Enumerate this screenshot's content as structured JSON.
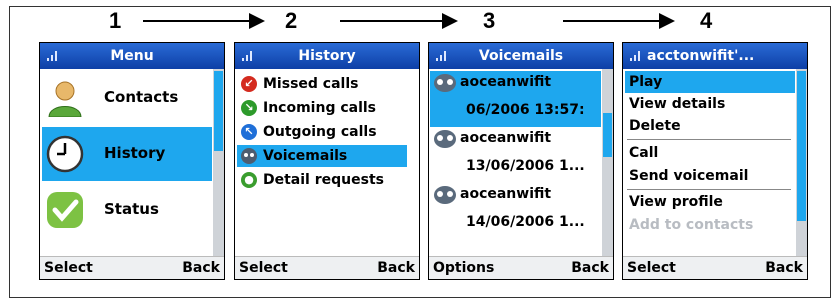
{
  "steps": [
    "1",
    "2",
    "3",
    "4"
  ],
  "screen1": {
    "title": "Menu",
    "items": [
      {
        "label": "Contacts",
        "icon": "contact-person-icon"
      },
      {
        "label": "History",
        "icon": "clock-icon",
        "selected": true
      },
      {
        "label": "Status",
        "icon": "checkmark-status-icon"
      }
    ],
    "softkey_left": "Select",
    "softkey_right": "Back"
  },
  "screen2": {
    "title": "History",
    "items": [
      {
        "label": "Missed calls",
        "icon": "missed-call-icon",
        "color": "#d42b1f"
      },
      {
        "label": "Incoming calls",
        "icon": "incoming-call-icon",
        "color": "#2d9a2b"
      },
      {
        "label": "Outgoing calls",
        "icon": "outgoing-call-icon",
        "color": "#1f6fd8"
      },
      {
        "label": "Voicemails",
        "icon": "voicemail-icon",
        "selected": true
      },
      {
        "label": "Detail requests",
        "icon": "detail-request-icon",
        "color": "#3a9d2e"
      }
    ],
    "softkey_left": "Select",
    "softkey_right": "Back"
  },
  "screen3": {
    "title": "Voicemails",
    "items": [
      {
        "name": "aoceanwifit",
        "date": "06/2006 13:57:",
        "selected": true
      },
      {
        "name": "aoceanwifit",
        "date": "13/06/2006 1..."
      },
      {
        "name": "aoceanwifit",
        "date": "14/06/2006 1..."
      }
    ],
    "softkey_left": "Options",
    "softkey_right": "Back"
  },
  "screen4": {
    "title": "acctonwifit'...",
    "items": [
      {
        "label": "Play",
        "selected": true
      },
      {
        "label": "View details"
      },
      {
        "label": "Delete"
      },
      {
        "label": "Call"
      },
      {
        "label": "Send voicemail"
      },
      {
        "label": "View profile"
      },
      {
        "label": "Add to contacts",
        "disabled": true
      }
    ],
    "softkey_left": "Select",
    "softkey_right": "Back"
  },
  "colors": {
    "titlebar": "#1a56c4",
    "selection": "#1ea7ee",
    "softkey_bar": "#eef0f2"
  }
}
